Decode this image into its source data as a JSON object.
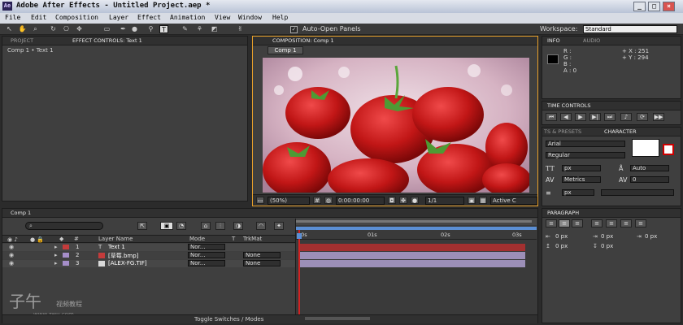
{
  "window": {
    "logo": "Ae",
    "title": "Adobe After Effects - Untitled Project.aep *",
    "btn_min": "_",
    "btn_max": "□",
    "btn_close": "×"
  },
  "menu": [
    "File",
    "Edit",
    "Composition",
    "Layer",
    "Effect",
    "Animation",
    "View",
    "Window",
    "Help"
  ],
  "toolbar": {
    "auto_open": "Auto-Open Panels",
    "workspace_label": "Workspace:",
    "workspace_value": "Standard"
  },
  "project_panel": {
    "tab_project": "PROJECT",
    "tab_effects": "EFFECT CONTROLS: Text 1",
    "crumb": "Comp 1 • Text 1"
  },
  "comp_panel": {
    "tab": "COMPOSITION: Comp 1",
    "subtab": "Comp 1",
    "zoom": "(50%)",
    "timecode": "0:00:00:00",
    "resolution": "1/1",
    "camera": "Active C"
  },
  "info_panel": {
    "tab_info": "INFO",
    "tab_audio": "AUDIO",
    "r": "R :",
    "g": "G :",
    "b": "B :",
    "a": "A : 0",
    "x": "+ X : 251",
    "y": "+ Y : 294"
  },
  "time_controls": {
    "tab": "TIME CONTROLS"
  },
  "character_panel": {
    "tab_presets": "TS & PRESETS",
    "tab_character": "CHARACTER",
    "font": "Arial",
    "style": "Regular",
    "size_unit": "px",
    "leading": "Auto",
    "kerning": "Metrics",
    "tracking": "0",
    "stroke_unit": "px"
  },
  "paragraph_panel": {
    "tab": "PARAGRAPH",
    "indent1": "0 px",
    "indent2": "0 px",
    "indent3": "0 px",
    "space1": "0 px",
    "space2": "0 px"
  },
  "timeline": {
    "tab": "Comp 1",
    "search_icon": "search-icon",
    "col_num": "#",
    "col_layer": "Layer Name",
    "col_mode": "Mode",
    "col_t": "T",
    "col_trkmat": "TrkMat",
    "ruler": [
      "00s",
      "01s",
      "02s",
      "03s"
    ],
    "layers": [
      {
        "num": "1",
        "name": "Text 1",
        "mode": "Nor...",
        "trkmat": "",
        "color": "#c43b3b",
        "bar": "#a33030"
      },
      {
        "num": "2",
        "name": "[草莓.bmp]",
        "mode": "Nor...",
        "trkmat": "None",
        "color": "#a58ec9",
        "bar": "#9c8fb8"
      },
      {
        "num": "3",
        "name": "[ALEX-FG.TIF]",
        "mode": "Nor...",
        "trkmat": "None",
        "color": "#a58ec9",
        "bar": "#9c8fb8"
      }
    ],
    "toggle": "Toggle Switches / Modes"
  },
  "watermark": {
    "line1": "子午",
    "line2": "视频教程",
    "line3": "www.zwu.com"
  },
  "colors": {
    "accent_orange": "#e8a02a",
    "playhead": "#d22222",
    "work_area": "#5b8fd4"
  }
}
